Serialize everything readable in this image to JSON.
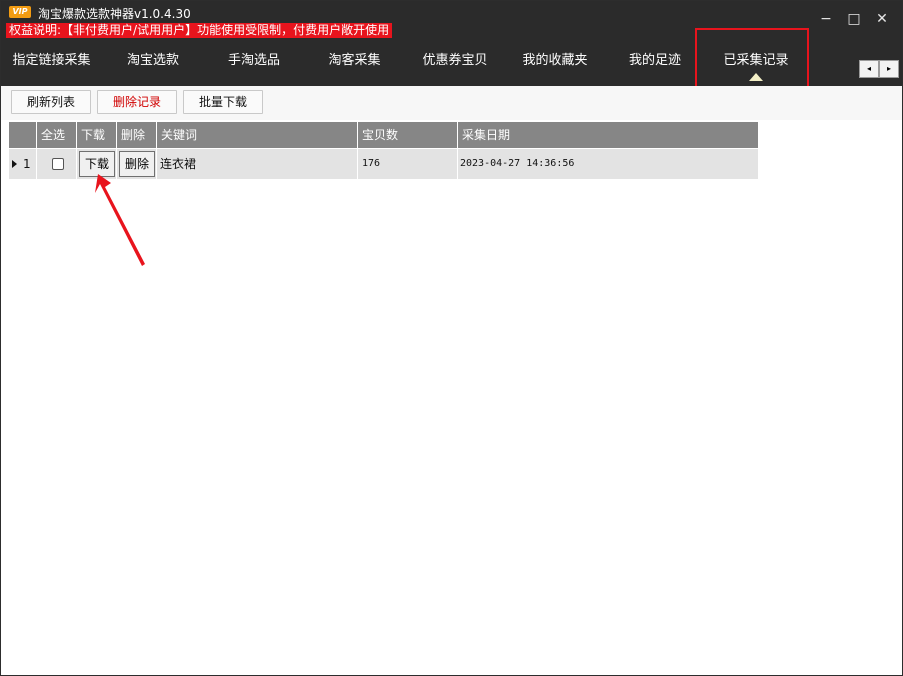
{
  "app": {
    "vip_label": "VIP",
    "title": "淘宝爆款选款神器v1.0.4.30",
    "notice": "权益说明:【非付费用户/试用用户】功能使用受限制，付费用户敞开使用"
  },
  "window_controls": {
    "minimize": "−",
    "maximize": "□",
    "close": "✕"
  },
  "tabs": [
    {
      "label": "指定链接采集"
    },
    {
      "label": "淘宝选款"
    },
    {
      "label": "手淘选品"
    },
    {
      "label": "淘客采集"
    },
    {
      "label": "优惠券宝贝"
    },
    {
      "label": "我的收藏夹"
    },
    {
      "label": "我的足迹"
    },
    {
      "label": "已采集记录",
      "active": true
    }
  ],
  "tab_scroll": {
    "left": "◂",
    "right": "▸"
  },
  "toolbar": {
    "refresh_label": "刷新列表",
    "delete_records_label": "删除记录",
    "batch_download_label": "批量下载"
  },
  "table": {
    "columns": [
      "全选",
      "下载",
      "删除",
      "关键词",
      "宝贝数",
      "采集日期"
    ],
    "rows": [
      {
        "index": "1",
        "download_label": "下载",
        "delete_label": "删除",
        "keyword": "连衣裙",
        "count": "176",
        "date": "2023-04-27 14:36:56"
      }
    ]
  },
  "colors": {
    "titlebar": "#2b2b2b",
    "notice_bg": "#e8141d",
    "highlight": "#e8141d",
    "header_bg": "#868686",
    "row_bg": "#e3e3e3"
  }
}
